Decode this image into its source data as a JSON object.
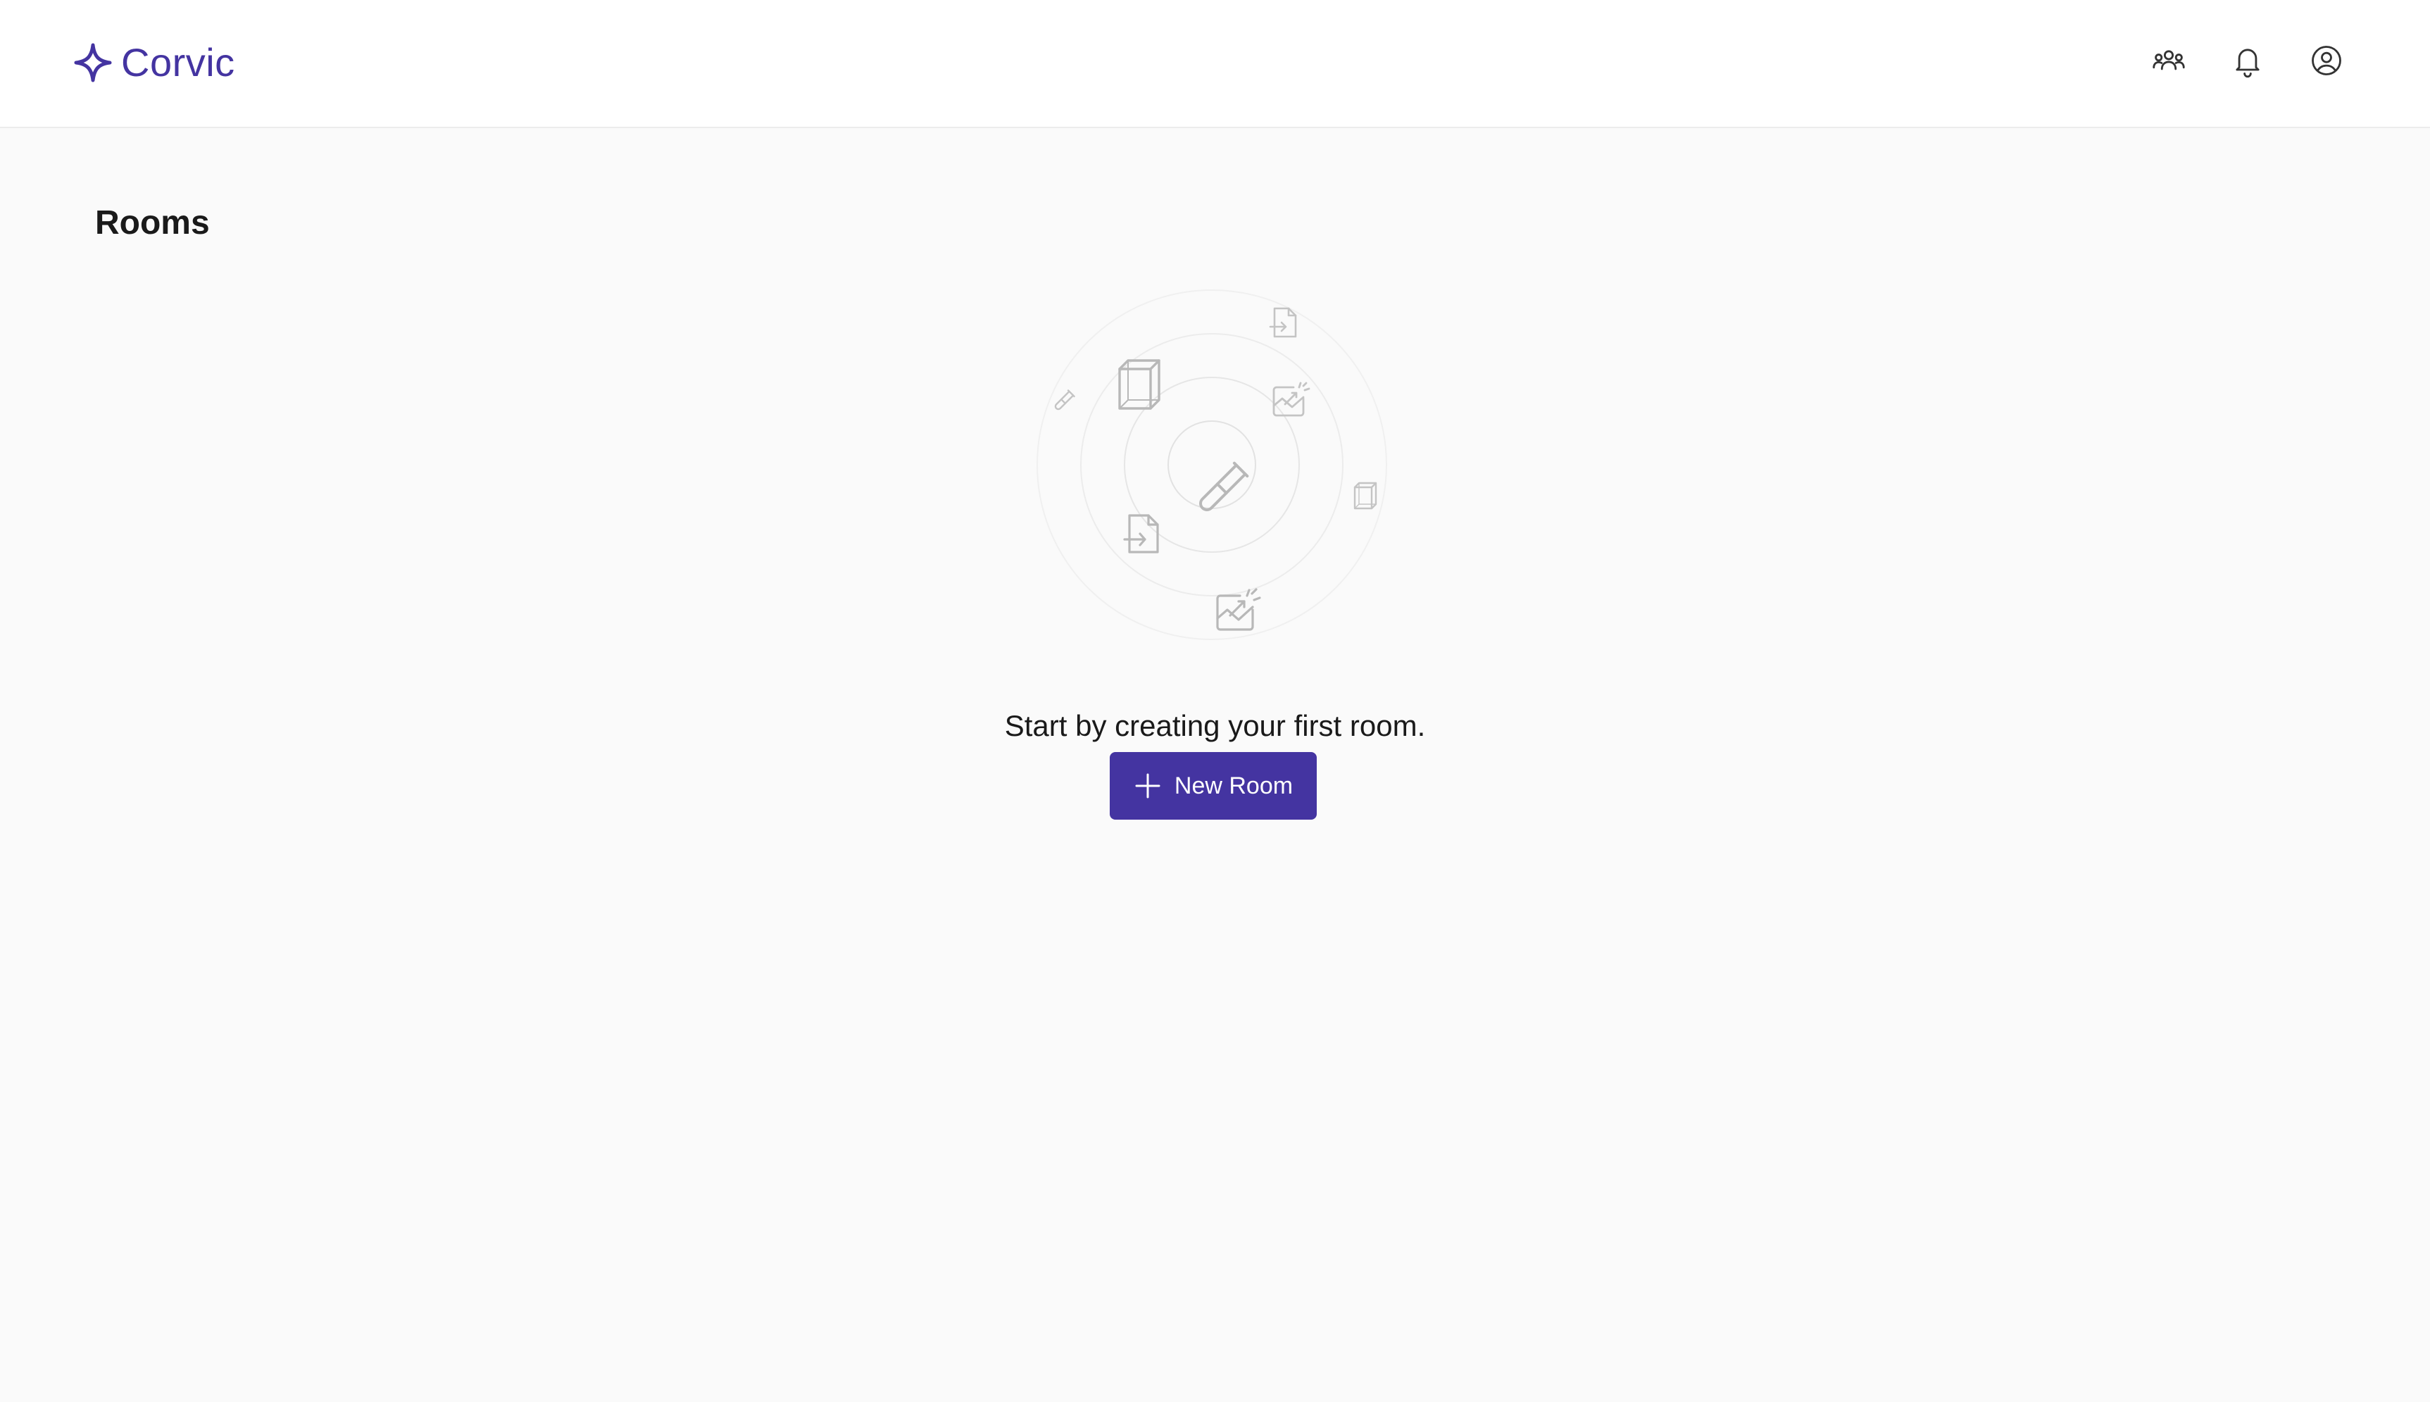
{
  "app": {
    "brand_name": "Corvic",
    "brand_color": "#4434a1"
  },
  "header": {
    "actions": [
      {
        "icon": "users-icon",
        "label": "Team"
      },
      {
        "icon": "bell-icon",
        "label": "Notifications"
      },
      {
        "icon": "user-circle-icon",
        "label": "Account"
      }
    ]
  },
  "main": {
    "title": "Rooms",
    "empty_state": {
      "message": "Start by creating your first room.",
      "illustration_icons": [
        "test-tube-icon",
        "cube-icon",
        "file-import-icon",
        "image-sparkle-icon"
      ],
      "button": {
        "label": "New Room",
        "icon": "plus-icon",
        "color": "#4434a1"
      }
    }
  }
}
